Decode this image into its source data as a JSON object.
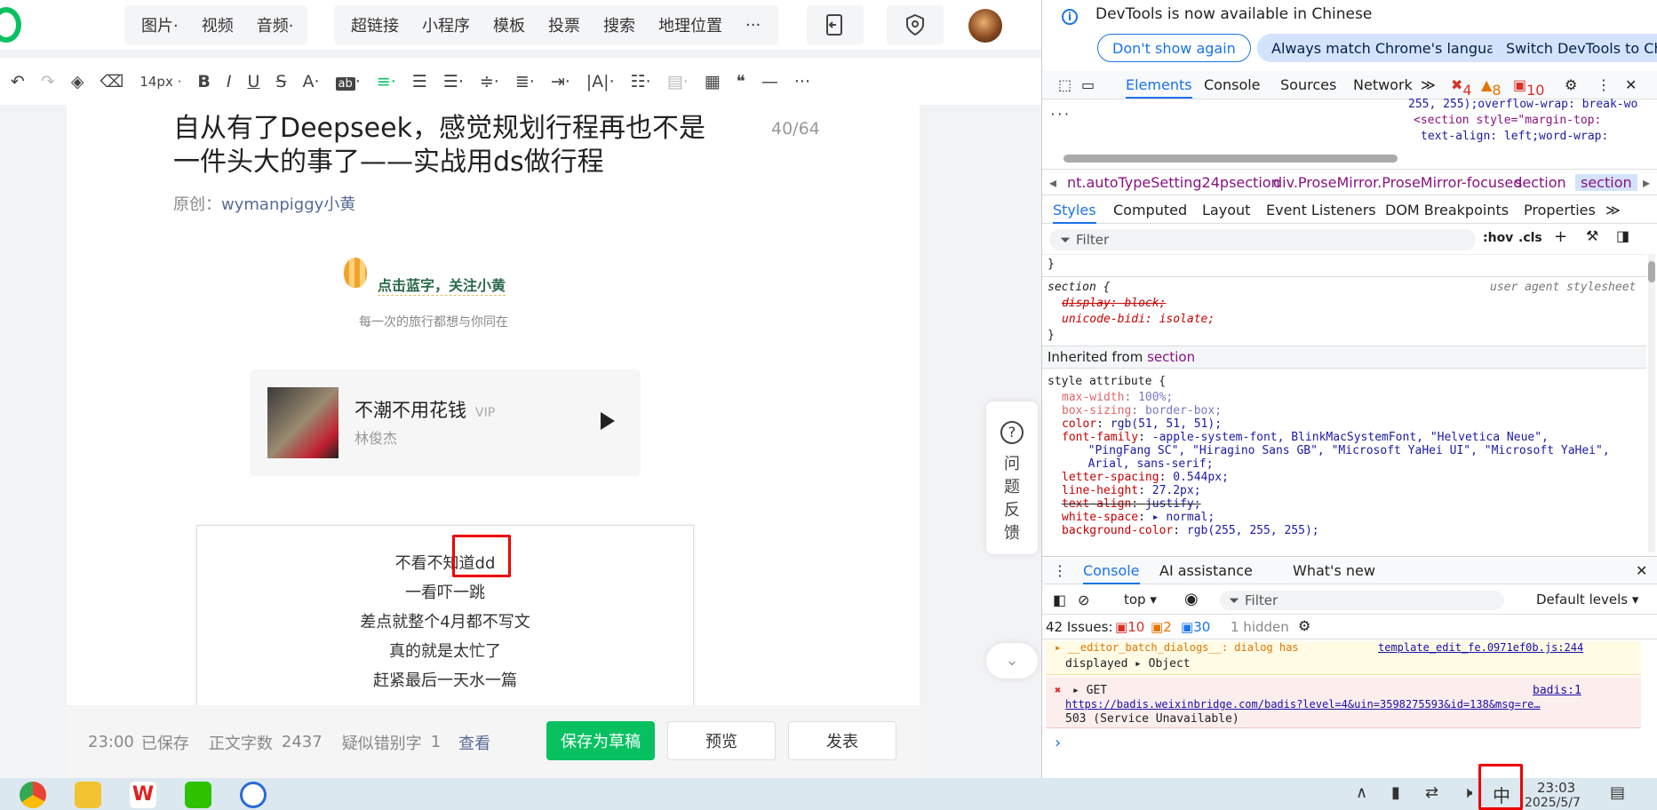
{
  "topbar": {
    "insert_group": [
      "图片",
      "视频",
      "音频"
    ],
    "tool_group": [
      "超链接",
      "小程序",
      "模板",
      "投票",
      "搜索",
      "地理位置",
      "···"
    ]
  },
  "toolbar": {
    "undo": "↶",
    "redo": "↷",
    "font_size": "14px",
    "bold": "B",
    "italic": "I",
    "underline": "U",
    "strike": "S",
    "more": "···"
  },
  "article": {
    "title": "自从有了Deepseek，感觉规划行程再也不是一件头大的事了——实战用ds做行程",
    "title_count": "40/64",
    "origin_label": "原创：",
    "author": "wymanpiggy小黄",
    "follow_text": "点击蓝字，关注小黄",
    "follow_sub": "每一次的旅行都想与你同在",
    "music": {
      "name": "不潮不用花钱",
      "badge": "VIP",
      "artist": "林俊杰"
    },
    "poem_lines": [
      "不看不知道dd",
      "一看吓一跳",
      "差点就整个4月都不写文",
      "真的就是太忙了",
      "赶紧最后一天水一篇"
    ]
  },
  "footer": {
    "save_time": "23:00",
    "saved": "已保存",
    "word_label": "正文字数",
    "word_count": "2437",
    "typo_label": "疑似错别字",
    "typo_count": "1",
    "view_link": "查看",
    "draft_button": "保存为草稿",
    "preview_button": "预览",
    "publish_button": "发表"
  },
  "feedback": {
    "label": "问题反馈",
    "chars": [
      "问",
      "题",
      "反",
      "馈"
    ]
  },
  "devtools": {
    "info_message": "DevTools is now available in Chinese",
    "dont_show": "Don't show again",
    "match_lang": "Always match Chrome's language",
    "switch_lang": "Switch DevTools to Chinese",
    "tabs": [
      "Elements",
      "Console",
      "Sources",
      "Network"
    ],
    "error_count": "4",
    "warning_count": "8",
    "issue_count": "10",
    "dom_line1": "255, 255);overflow-wrap: break-wo",
    "dom_line2": "<section style=\"margin-top:",
    "dom_line3": "text-align: left;word-wrap:",
    "breadcrumbs": [
      "nt.autoTypeSetting24psection",
      "div.ProseMirror.ProseMirror-focused",
      "section",
      "section"
    ],
    "style_tabs": [
      "Styles",
      "Computed",
      "Layout",
      "Event Listeners",
      "DOM Breakpoints",
      "Properties"
    ],
    "filter_placeholder": "Filter",
    "hov": ":hov",
    "cls": ".cls",
    "css": {
      "brace": "}",
      "selector": "section {",
      "ua_label": "user agent stylesheet",
      "display": "display: block;",
      "unicode_bidi": "unicode-bidi: isolate;",
      "close": "}",
      "inherited_label": "Inherited from",
      "inherited_from": "section",
      "style_attr": "style attribute {",
      "lines": [
        [
          "max-width",
          "100%;"
        ],
        [
          "box-sizing",
          "border-box;"
        ],
        [
          "color",
          "rgb(51, 51, 51);"
        ],
        [
          "font-family",
          "-apple-system-font, BlinkMacSystemFont, \"Helvetica Neue\","
        ],
        [
          "",
          "  \"PingFang SC\", \"Hiragino Sans GB\", \"Microsoft YaHei UI\", \"Microsoft YaHei\","
        ],
        [
          "",
          "  Arial, sans-serif;"
        ],
        [
          "letter-spacing",
          "0.544px;"
        ],
        [
          "line-height",
          "27.2px;"
        ],
        [
          "text-align",
          "justify;"
        ],
        [
          "white-space",
          "▸ normal;"
        ],
        [
          "background-color",
          "rgb(255, 255, 255);"
        ]
      ]
    },
    "console_tabs": [
      "Console",
      "AI assistance",
      "What's new"
    ],
    "context": "top",
    "default_levels": "Default levels",
    "issues_label": "42 Issues:",
    "issues_err": "10",
    "issues_warn": "2",
    "issues_info": "30",
    "hidden": "1 hidden",
    "warn_line1": "▸ __editor_batch_dialogs__: dialog has",
    "warn_link": "template_edit_fe.0971ef0b.js:244",
    "warn_line2": "displayed",
    "warn_obj": "▸ Object",
    "err_get": "▸ GET",
    "err_src": "badis:1",
    "err_url": "https://badis.weixinbridge.com/badis?level=4&uin=3598275593&id=138&msg=re…",
    "err_status": "503 (Service Unavailable)",
    "prompt": "›"
  },
  "taskbar": {
    "ime": "中",
    "time": "23:03",
    "date": "2025/5/7"
  },
  "colors": {
    "accent": "#07c160",
    "link": "#576b95",
    "devtools_blue": "#1a73e8",
    "highlight": "#e00000"
  }
}
